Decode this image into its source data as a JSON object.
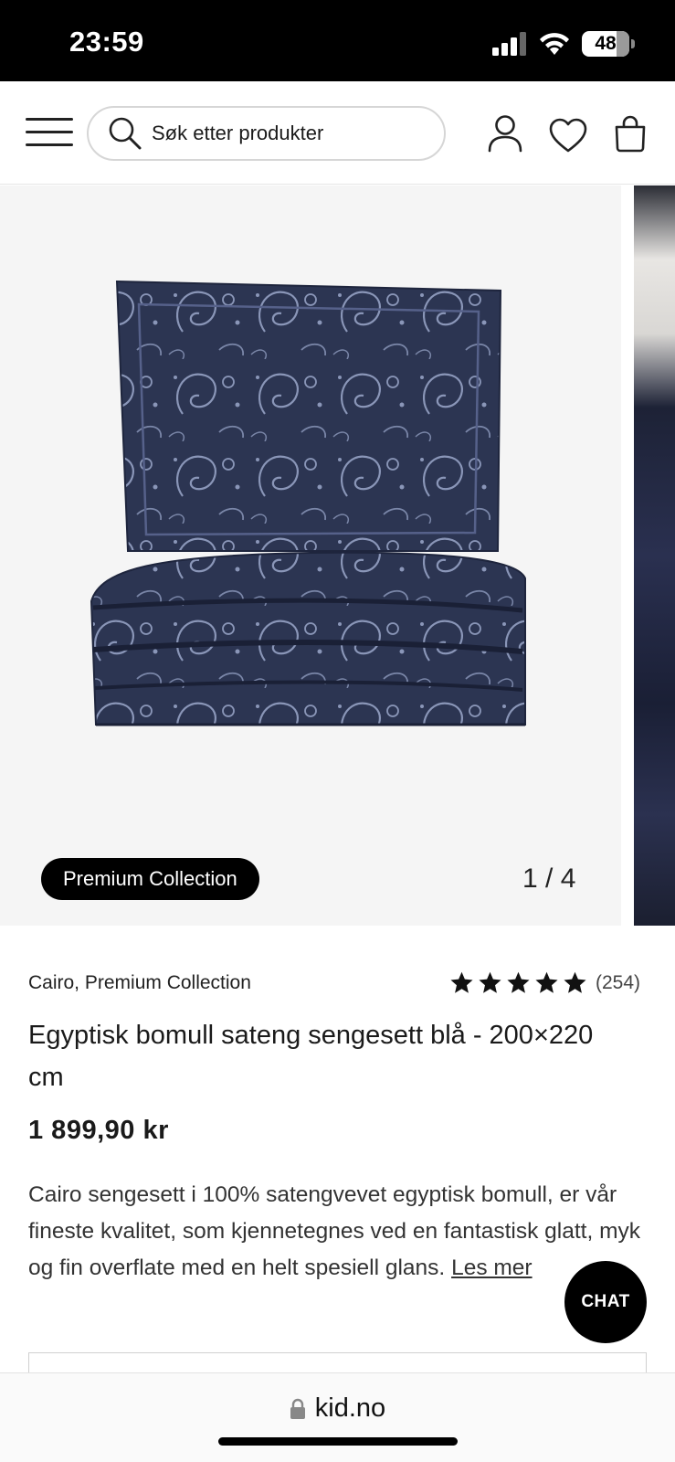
{
  "status_bar": {
    "time": "23:59",
    "battery": "48",
    "icons": [
      "cellular-signal-icon",
      "wifi-icon",
      "battery-icon"
    ]
  },
  "header": {
    "menu_icon": "hamburger-menu-icon",
    "search": {
      "placeholder": "Søk etter produkter",
      "value": "",
      "icon": "search-icon"
    },
    "icons": [
      "user-icon",
      "heart-icon",
      "shopping-bag-icon"
    ]
  },
  "gallery": {
    "badge": "Premium Collection",
    "counter": "1 / 4",
    "current_index": 1,
    "total": 4
  },
  "product": {
    "brand": "Cairo, Premium Collection",
    "rating": 5,
    "review_count": "(254)",
    "title": "Egyptisk bomull sateng sengesett blå - 200×220 cm",
    "price": "1 899,90 kr",
    "description": "Cairo sengesett i 100% satengvevet egyptisk bomull, er vår fineste kvalitet, som kjennetegnes ved en fantastisk glatt, myk og fin overflate med en helt spesiell glans.",
    "read_more": "Les mer"
  },
  "chat": {
    "label": "CHAT"
  },
  "browser": {
    "url": "kid.no"
  },
  "colors": {
    "badge_bg": "#000000",
    "fabric": "#2c3552",
    "pattern": "#8a96b8"
  }
}
